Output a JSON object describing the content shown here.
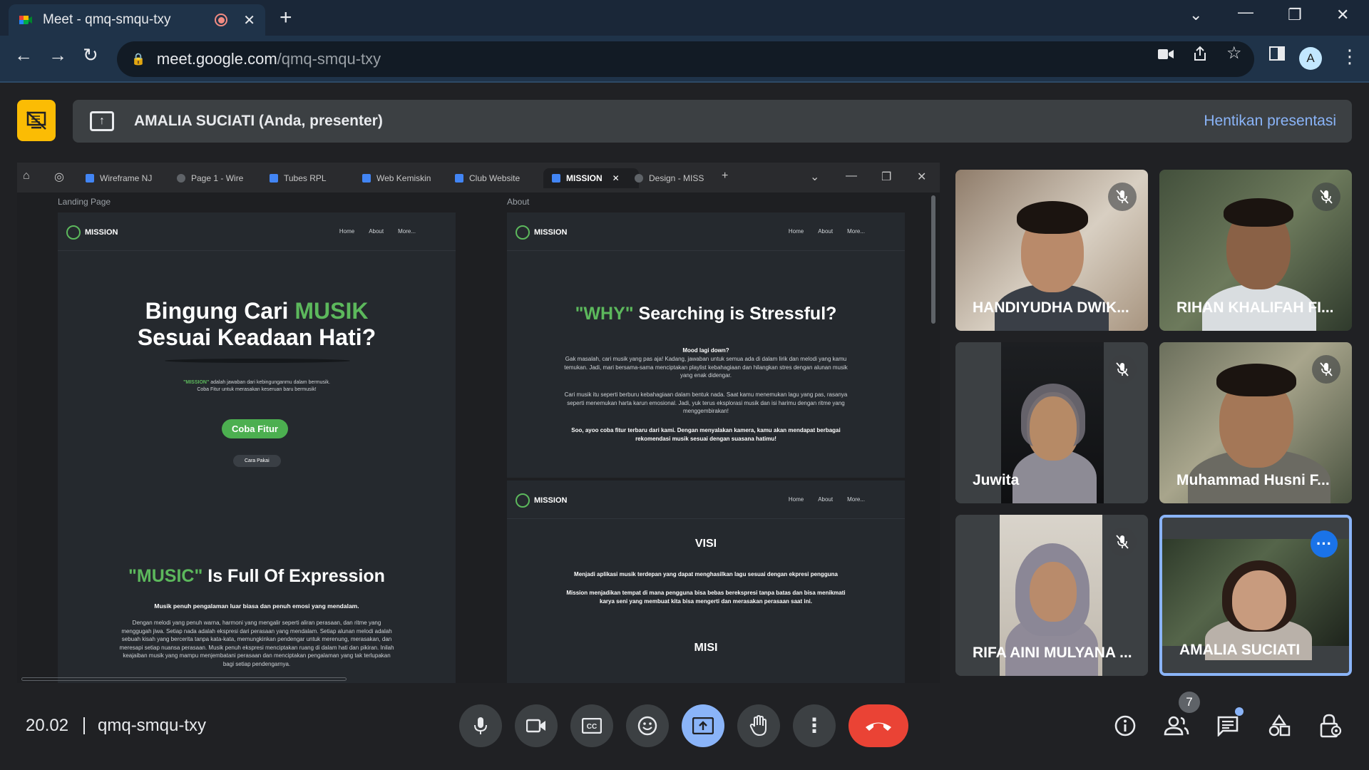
{
  "browser": {
    "tab_title": "Meet - qmq-smqu-txy",
    "new_tab": "+",
    "url_host": "meet.google.com",
    "url_path": "/qmq-smqu-txy",
    "profile_initial": "A"
  },
  "presenter": {
    "label": "AMALIA SUCIATI (Anda, presenter)",
    "stop_label": "Hentikan presentasi"
  },
  "shared": {
    "tabs": [
      "Wireframe NJ",
      "Page 1 - Wire",
      "Tubes RPL",
      "Web Kemiskin",
      "Club Website",
      "MISSION",
      "Design - MISS"
    ],
    "frame_left_label": "Landing Page",
    "frame_right_label": "About",
    "brand": "MISSION",
    "nav_links": [
      "Home",
      "About",
      "More..."
    ],
    "hero_line1_a": "Bingung Cari ",
    "hero_line1_b": "MUSIK",
    "hero_line2": "Sesuai Keadaan Hati?",
    "hero_sub_a": "\"MISSION\"",
    "hero_sub_b": " adalah jawaban dari kebingunganmu dalam bermusik.",
    "hero_sub_c": "Coba Fitur untuk merasakan keseruan baru bermusik!",
    "cta_primary": "Coba Fitur",
    "cta_secondary": "Cara Pakai",
    "music_a": "\"MUSIC\"",
    "music_b": " Is Full Of Expression",
    "music_lead": "Musik penuh pengalaman luar biasa dan penuh emosi yang mendalam.",
    "music_body": "Dengan melodi yang penuh warna, harmoni yang mengalir seperti aliran perasaan, dan ritme yang menggugah jiwa. Setiap nada adalah ekspresi dari perasaan yang mendalam. Setiap alunan melodi adalah sebuah kisah yang bercerita tanpa kata-kata, memungkinkan pendengar untuk merenung, merasakan, dan meresapi setiap nuansa perasaan. Musik penuh ekspresi menciptakan ruang di dalam hati dan pikiran. Inilah keajaiban musik yang mampu menjembatani perasaan dan menciptakan pengalaman yang tak terlupakan bagi setiap pendengarnya.",
    "why_a": "\"WHY\"",
    "why_b": " Searching is Stressful?",
    "why_lead": "Mood lagi down?",
    "why_p1": "Gak masalah, cari musik yang pas aja! Kadang, jawaban untuk semua ada di dalam lirik dan melodi yang kamu temukan. Jadi, mari bersama-sama menciptakan playlist kebahagiaan dan hilangkan stres dengan alunan musik yang enak didengar.",
    "why_p2": "Cari musik itu seperti berburu kebahagiaan dalam bentuk nada. Saat kamu menemukan lagu yang pas, rasanya seperti menemukan harta karun emosional. Jadi, yuk terus eksplorasi musik dan isi harimu dengan ritme yang menggembirakan!",
    "why_p3": "Soo, ayoo coba fitur terbaru dari kami. Dengan menyalakan kamera, kamu akan mendapat berbagai rekomendasi musik sesuai dengan suasana hatimu!",
    "visi_title": "VISI",
    "visi_text": "Menjadi aplikasi musik terdepan yang dapat menghasilkan lagu sesuai dengan ekpresi pengguna",
    "mission_text": "Mission menjadikan tempat di mana pengguna bisa bebas berekspresi tanpa batas dan bisa menikmati karya seni yang membuat kita bisa mengerti dan merasakan perasaan saat ini.",
    "misi_title": "MISI"
  },
  "participants": [
    {
      "name": "HANDIYUDHA DWIK...",
      "muted": true
    },
    {
      "name": "RIHAN KHALIFAH FI...",
      "muted": true
    },
    {
      "name": "Juwita",
      "muted": true
    },
    {
      "name": "Muhammad Husni F...",
      "muted": true
    },
    {
      "name": "RIFA AINI MULYANA ...",
      "muted": true
    },
    {
      "name": "AMALIA SUCIATI",
      "muted": false
    }
  ],
  "bottom": {
    "time": "20.02",
    "meeting_code": "qmq-smqu-txy",
    "people_count": "7"
  },
  "colors": {
    "accent_blue": "#8ab4f8",
    "end_call_red": "#ea4335",
    "present_yellow": "#fbbc04",
    "brand_green": "#5cb85c"
  }
}
